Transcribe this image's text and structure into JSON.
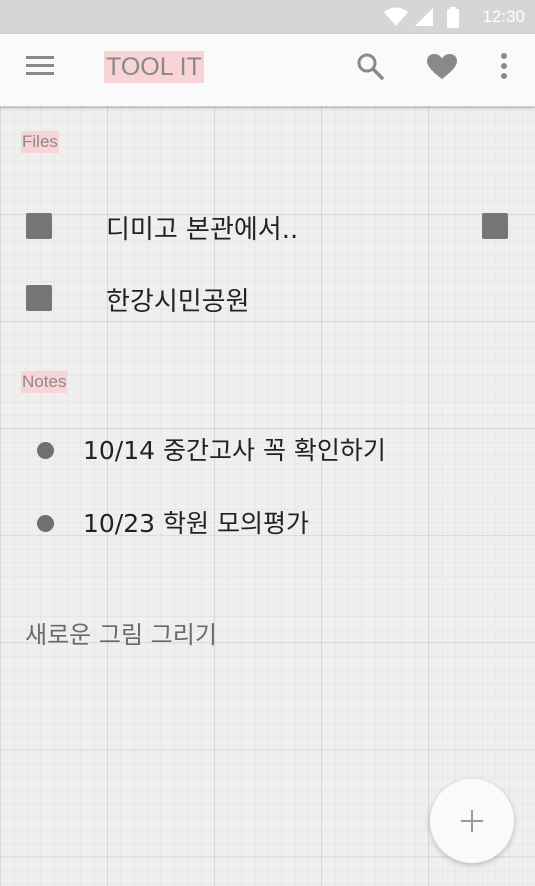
{
  "status_bar": {
    "time": "12:30",
    "icons": [
      "wifi-icon",
      "signal-icon",
      "battery-icon"
    ]
  },
  "app_bar": {
    "title": "TOOL IT",
    "icons": [
      "menu-icon",
      "search-icon",
      "heart-icon",
      "more-vert-icon"
    ]
  },
  "files": {
    "header": "Files",
    "items": [
      {
        "label": "디미고 본관에서..",
        "icon": "square-icon",
        "has_trailing_icon": true
      },
      {
        "label": "한강시민공원",
        "icon": "square-icon",
        "has_trailing_icon": false
      }
    ]
  },
  "notes": {
    "header": "Notes",
    "items": [
      {
        "label": "10/14 중간고사 꼭 확인하기",
        "icon": "bullet-icon"
      },
      {
        "label": "10/23 학원 모의평가",
        "icon": "bullet-icon"
      }
    ]
  },
  "new_drawing": {
    "label": "새로운 그림 그리기"
  },
  "fab": {
    "icon": "plus-icon"
  },
  "colors": {
    "accent_highlight": "#f9d4d6",
    "status_bar": "#d6d6d6",
    "icon_gray": "#757575"
  }
}
